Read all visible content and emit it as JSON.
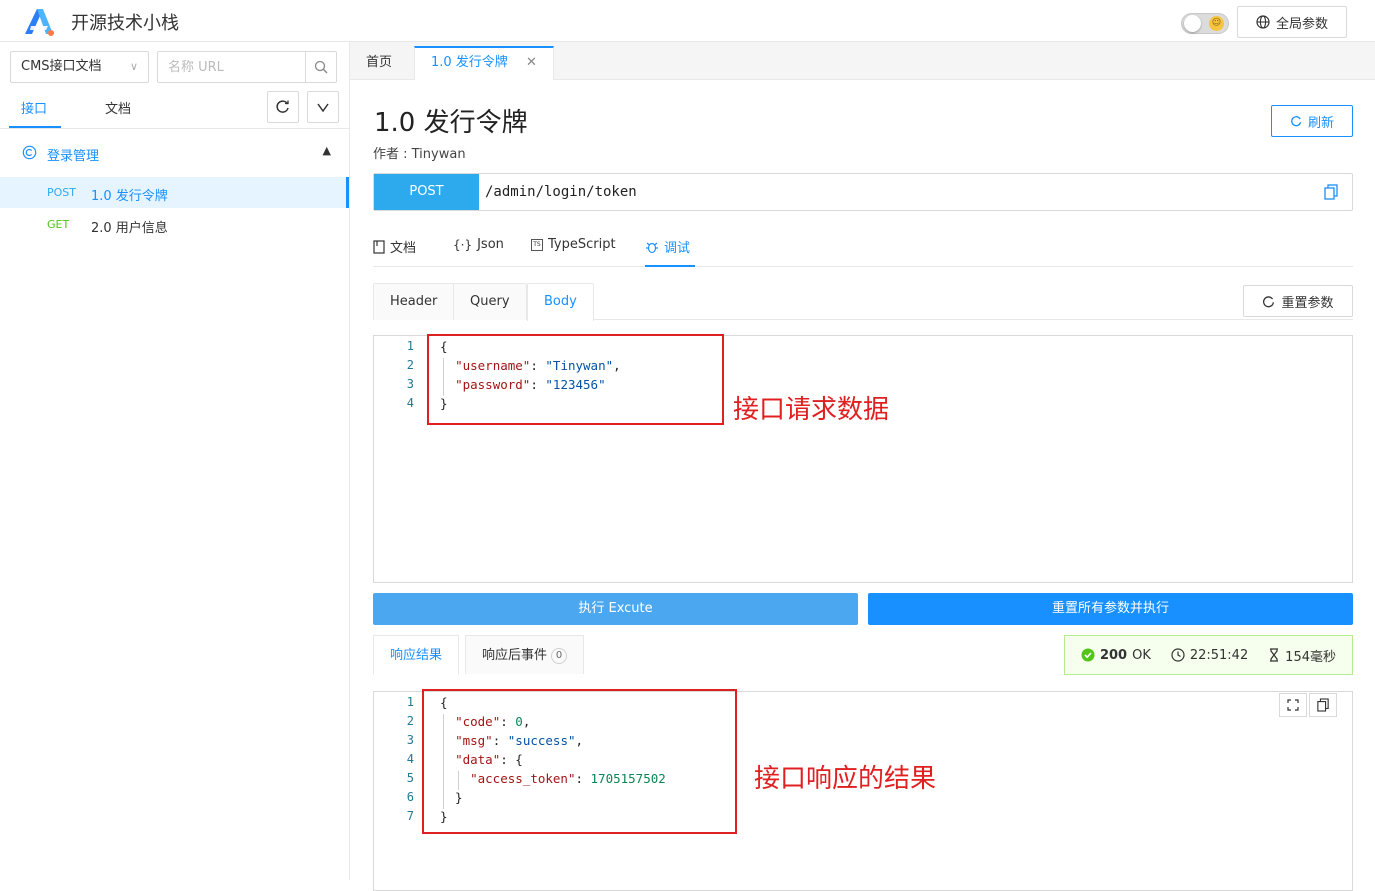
{
  "header": {
    "app_title": "开源技术小栈",
    "global_params_label": "全局参数",
    "icons": {
      "logo": "logo-a-icon",
      "globe": "globe-icon"
    }
  },
  "sidebar": {
    "project_select": "CMS接口文档",
    "search_placeholder": "名称 URL",
    "tabs": [
      {
        "label": "接口",
        "active": true
      },
      {
        "label": "文档",
        "active": false
      }
    ],
    "group": {
      "label": "登录管理",
      "expanded": true
    },
    "items": [
      {
        "method": "POST",
        "name": "1.0 发行令牌",
        "active": true
      },
      {
        "method": "GET",
        "name": "2.0 用户信息",
        "active": false
      }
    ]
  },
  "page_tabs": [
    {
      "label": "首页",
      "active": false
    },
    {
      "label": "1.0 发行令牌",
      "active": true
    }
  ],
  "api": {
    "title": "1.0 发行令牌",
    "author": "作者 : Tinywan",
    "refresh_label": "刷新",
    "method": "POST",
    "url": "/admin/login/token"
  },
  "doc_tabs": [
    {
      "label": "文档",
      "icon": "document-icon"
    },
    {
      "label": "Json",
      "icon": "braces-icon"
    },
    {
      "label": "TypeScript",
      "icon": "typescript-icon"
    },
    {
      "label": "调试",
      "icon": "bug-icon",
      "active": true
    }
  ],
  "request": {
    "tabs": [
      {
        "label": "Header"
      },
      {
        "label": "Query"
      },
      {
        "label": "Body",
        "active": true
      }
    ],
    "reset_label": "重置参数",
    "line_numbers": [
      "1",
      "2",
      "3",
      "4"
    ],
    "body_lines": [
      "{",
      "  \"username\": \"Tinywan\",",
      "  \"password\": \"123456\"",
      "}"
    ]
  },
  "actions": {
    "execute_label": "执行 Excute",
    "reset_execute_label": "重置所有参数并执行"
  },
  "response": {
    "tabs": [
      {
        "label": "响应结果",
        "active": true
      },
      {
        "label": "响应后事件",
        "count": "0"
      }
    ],
    "status_code": "200",
    "status_text": "OK",
    "time": "22:51:42",
    "duration": "154毫秒",
    "line_numbers": [
      "1",
      "2",
      "3",
      "4",
      "5",
      "6",
      "7"
    ],
    "body_lines": [
      "{",
      "  \"code\": 0,",
      "  \"msg\": \"success\",",
      "  \"data\": {",
      "    \"access_token\": 1705157502",
      "  }",
      "}"
    ]
  },
  "annotations": {
    "request_note": "接口请求数据",
    "response_note": "接口响应的结果"
  },
  "colors": {
    "primary": "#1890ff",
    "post": "#2daaee",
    "get": "#52c41a",
    "annotation": "#e02020",
    "success": "#52c41a"
  }
}
